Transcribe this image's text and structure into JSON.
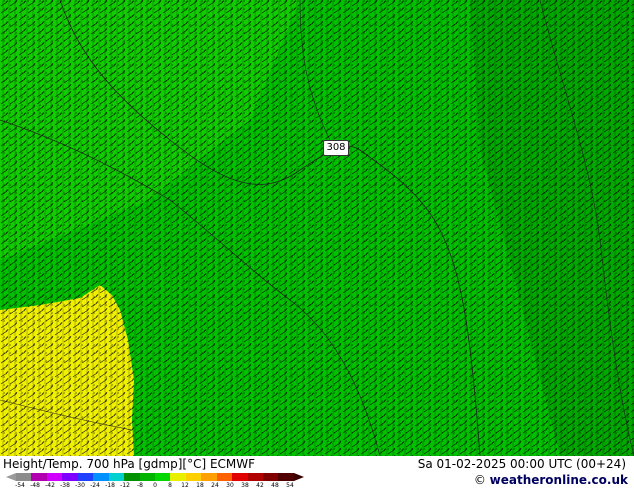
{
  "header": {
    "title": "Height/Temp. 700 hPa [gdmp][°C] ECMWF",
    "datetime": "Sa 01-02-2025 00:00 UTC (00+24)"
  },
  "credit": {
    "prefix": "© ",
    "brand": "weatheronline.co.uk"
  },
  "map": {
    "contour_label": "308",
    "colors": {
      "field_green": "#00c000",
      "field_green_dark": "#00a000",
      "field_green_light": "#20d000",
      "warm_yellow": "#f0f000",
      "barb": "#000000",
      "contour": "#202020"
    }
  },
  "legend": {
    "ticks": [
      "-54",
      "-48",
      "-42",
      "-38",
      "-30",
      "-24",
      "-18",
      "-12",
      "-8",
      "0",
      "8",
      "12",
      "18",
      "24",
      "30",
      "38",
      "42",
      "48",
      "54"
    ],
    "colors": [
      "#8c8c8c",
      "#b000b0",
      "#d000ff",
      "#8000ff",
      "#2040ff",
      "#0090ff",
      "#00d0d0",
      "#009000",
      "#00b400",
      "#00d800",
      "#e8f000",
      "#ffd000",
      "#ffa000",
      "#ff6000",
      "#e00000",
      "#b00000",
      "#800000",
      "#500000"
    ]
  }
}
